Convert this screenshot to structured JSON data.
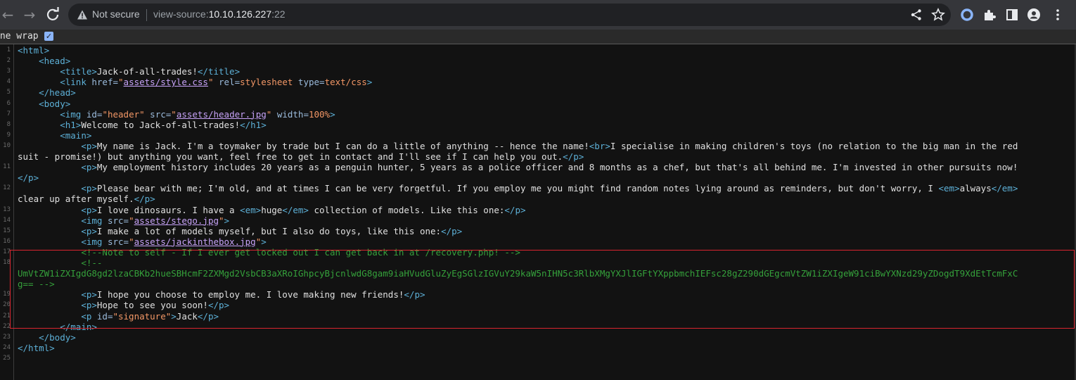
{
  "browser": {
    "security_label": "Not secure",
    "url_scheme": "view-source:",
    "url_host": "10.10.126.227",
    "url_port": ":22"
  },
  "viewer": {
    "line_wrap_label": "ine wrap",
    "line_wrap_checked": true,
    "highlight_color": "#d9252f"
  },
  "source_lines": [
    {
      "n": "1",
      "segments": [
        [
          "t",
          "<html>"
        ]
      ]
    },
    {
      "n": "2",
      "segments": [
        [
          "s",
          "    "
        ],
        [
          "t",
          "<head>"
        ]
      ]
    },
    {
      "n": "3",
      "segments": [
        [
          "s",
          "        "
        ],
        [
          "t",
          "<title>"
        ],
        [
          "s",
          "Jack-of-all-trades!"
        ],
        [
          "t",
          "</title>"
        ]
      ]
    },
    {
      "n": "4",
      "segments": [
        [
          "s",
          "        "
        ],
        [
          "t",
          "<link "
        ],
        [
          "a",
          "href="
        ],
        [
          "v",
          "\""
        ],
        [
          "lk",
          "assets/style.css"
        ],
        [
          "v",
          "\""
        ],
        [
          "a",
          " rel="
        ],
        [
          "v",
          "stylesheet"
        ],
        [
          "a",
          " type="
        ],
        [
          "v",
          "text/css"
        ],
        [
          "t",
          ">"
        ]
      ]
    },
    {
      "n": "5",
      "segments": [
        [
          "s",
          "    "
        ],
        [
          "t",
          "</head>"
        ]
      ]
    },
    {
      "n": "6",
      "segments": [
        [
          "s",
          "    "
        ],
        [
          "t",
          "<body>"
        ]
      ]
    },
    {
      "n": "7",
      "segments": [
        [
          "s",
          "        "
        ],
        [
          "t",
          "<img "
        ],
        [
          "a",
          "id="
        ],
        [
          "v",
          "\"header\""
        ],
        [
          "a",
          " src="
        ],
        [
          "v",
          "\""
        ],
        [
          "lk",
          "assets/header.jpg"
        ],
        [
          "v",
          "\""
        ],
        [
          "a",
          " width="
        ],
        [
          "v",
          "100%"
        ],
        [
          "t",
          ">"
        ]
      ]
    },
    {
      "n": "8",
      "segments": [
        [
          "s",
          "        "
        ],
        [
          "t",
          "<h1>"
        ],
        [
          "s",
          "Welcome to Jack-of-all-trades!"
        ],
        [
          "t",
          "</h1>"
        ]
      ]
    },
    {
      "n": "9",
      "segments": [
        [
          "s",
          "        "
        ],
        [
          "t",
          "<main>"
        ]
      ]
    },
    {
      "n": "10",
      "segments": [
        [
          "s",
          "            "
        ],
        [
          "t",
          "<p>"
        ],
        [
          "s",
          "My name is Jack. I'm a toymaker by trade but I can do a little of anything -- hence the name!"
        ],
        [
          "t",
          "<br>"
        ],
        [
          "s",
          "I specialise in making children's toys (no relation to the big man in the red"
        ]
      ]
    },
    {
      "n": "",
      "segments": [
        [
          "s",
          "suit - promise!) but anything you want, feel free to get in contact and I'll see if I can help you out."
        ],
        [
          "t",
          "</p>"
        ]
      ]
    },
    {
      "n": "11",
      "segments": [
        [
          "s",
          "            "
        ],
        [
          "t",
          "<p>"
        ],
        [
          "s",
          "My employment history includes 20 years as a penguin hunter, 5 years as a police officer and 8 months as a chef, but that's all behind me. I'm invested in other pursuits now!"
        ]
      ]
    },
    {
      "n": "",
      "segments": [
        [
          "t",
          "</p>"
        ]
      ]
    },
    {
      "n": "12",
      "segments": [
        [
          "s",
          "            "
        ],
        [
          "t",
          "<p>"
        ],
        [
          "s",
          "Please bear with me; I'm old, and at times I can be very forgetful. If you employ me you might find random notes lying around as reminders, but don't worry, I "
        ],
        [
          "t",
          "<em>"
        ],
        [
          "s",
          "always"
        ],
        [
          "t",
          "</em>"
        ]
      ]
    },
    {
      "n": "",
      "segments": [
        [
          "s",
          "clear up after myself."
        ],
        [
          "t",
          "</p>"
        ]
      ]
    },
    {
      "n": "13",
      "segments": [
        [
          "s",
          "            "
        ],
        [
          "t",
          "<p>"
        ],
        [
          "s",
          "I love dinosaurs. I have a "
        ],
        [
          "t",
          "<em>"
        ],
        [
          "s",
          "huge"
        ],
        [
          "t",
          "</em>"
        ],
        [
          "s",
          " collection of models. Like this one:"
        ],
        [
          "t",
          "</p>"
        ]
      ]
    },
    {
      "n": "14",
      "segments": [
        [
          "s",
          "            "
        ],
        [
          "t",
          "<img "
        ],
        [
          "a",
          "src="
        ],
        [
          "v",
          "\""
        ],
        [
          "lk",
          "assets/stego.jpg"
        ],
        [
          "v",
          "\""
        ],
        [
          "t",
          ">"
        ]
      ]
    },
    {
      "n": "15",
      "segments": [
        [
          "s",
          "            "
        ],
        [
          "t",
          "<p>"
        ],
        [
          "s",
          "I make a lot of models myself, but I also do toys, like this one:"
        ],
        [
          "t",
          "</p>"
        ]
      ]
    },
    {
      "n": "16",
      "segments": [
        [
          "s",
          "            "
        ],
        [
          "t",
          "<img "
        ],
        [
          "a",
          "src="
        ],
        [
          "v",
          "\""
        ],
        [
          "lk",
          "assets/jackinthebox.jpg"
        ],
        [
          "v",
          "\""
        ],
        [
          "t",
          ">"
        ]
      ]
    },
    {
      "n": "17",
      "segments": [
        [
          "s",
          "            "
        ],
        [
          "c",
          "<!--Note to self - If I ever get locked out I can get back in at /recovery.php! -->"
        ]
      ]
    },
    {
      "n": "18",
      "segments": [
        [
          "s",
          "            "
        ],
        [
          "c",
          "<!--"
        ]
      ]
    },
    {
      "n": "",
      "segments": [
        [
          "c",
          "UmVtZW1iZXIgdG8gd2lzaCBKb2hueSBHcmF2ZXMgd2VsbCB3aXRoIGhpcyBjcnlwdG8gam9iaHVudGluZyEgSGlzIGVuY29kaW5nIHN5c3RlbXMgYXJlIGFtYXppbmchIEFsc28gZ290dGEgcmVtZW1iZXIgeW91ciBwYXNzd29yZDogdT9XdEtTcmFxC"
        ]
      ]
    },
    {
      "n": "",
      "segments": [
        [
          "c",
          "g== -->"
        ]
      ]
    },
    {
      "n": "19",
      "segments": [
        [
          "s",
          "            "
        ],
        [
          "t",
          "<p>"
        ],
        [
          "s",
          "I hope you choose to employ me. I love making new friends!"
        ],
        [
          "t",
          "</p>"
        ]
      ]
    },
    {
      "n": "20",
      "segments": [
        [
          "s",
          "            "
        ],
        [
          "t",
          "<p>"
        ],
        [
          "s",
          "Hope to see you soon!"
        ],
        [
          "t",
          "</p>"
        ]
      ]
    },
    {
      "n": "21",
      "segments": [
        [
          "s",
          "            "
        ],
        [
          "t",
          "<p "
        ],
        [
          "a",
          "id="
        ],
        [
          "v",
          "\"signature\""
        ],
        [
          "t",
          ">"
        ],
        [
          "s",
          "Jack"
        ],
        [
          "t",
          "</p>"
        ]
      ]
    },
    {
      "n": "22",
      "segments": [
        [
          "s",
          "        "
        ],
        [
          "t",
          "</main>"
        ]
      ]
    },
    {
      "n": "23",
      "segments": [
        [
          "s",
          "    "
        ],
        [
          "t",
          "</body>"
        ]
      ]
    },
    {
      "n": "24",
      "segments": [
        [
          "t",
          "</html>"
        ]
      ]
    },
    {
      "n": "25",
      "segments": []
    }
  ]
}
